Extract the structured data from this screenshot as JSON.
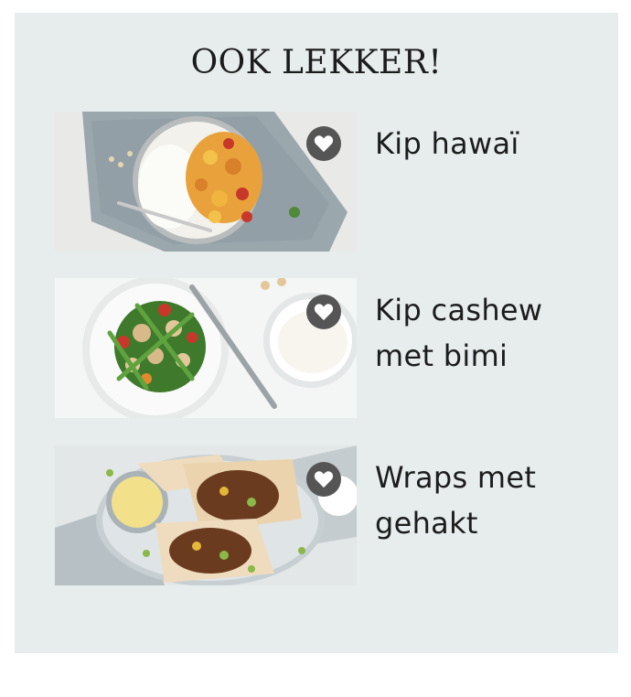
{
  "section": {
    "title": "OOK LEKKER!"
  },
  "recipes": [
    {
      "name": "Kip hawaï",
      "icon": "heart-icon"
    },
    {
      "name": "Kip cashew met bimi",
      "icon": "heart-icon"
    },
    {
      "name": "Wraps met gehakt",
      "icon": "heart-icon"
    }
  ],
  "colors": {
    "panel_background": "#e7edec",
    "favorite_button": "#555555",
    "text": "#1c1c1c"
  }
}
